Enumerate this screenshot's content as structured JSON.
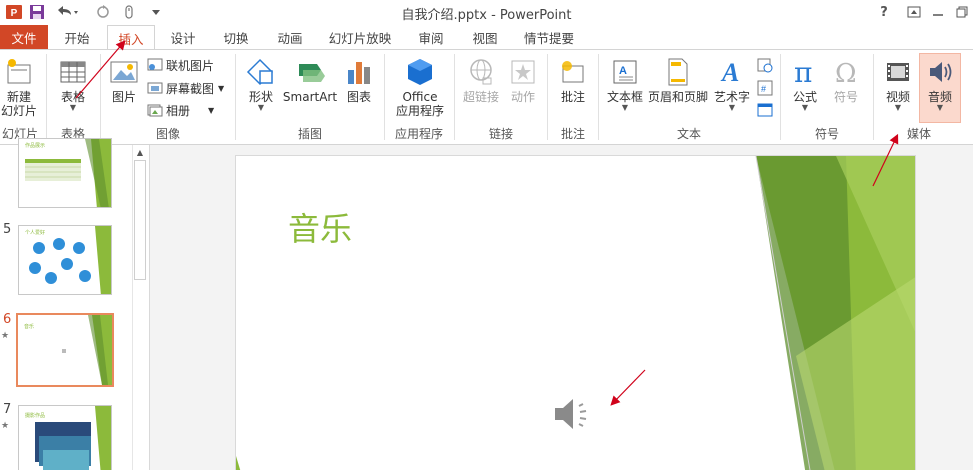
{
  "window": {
    "title": "自我介绍.pptx - PowerPoint",
    "help": "?"
  },
  "tabs": [
    {
      "label": "文件"
    },
    {
      "label": "开始"
    },
    {
      "label": "插入"
    },
    {
      "label": "设计"
    },
    {
      "label": "切换"
    },
    {
      "label": "动画"
    },
    {
      "label": "幻灯片放映"
    },
    {
      "label": "审阅"
    },
    {
      "label": "视图"
    },
    {
      "label": "情节提要"
    }
  ],
  "ribbon": {
    "slides": {
      "new_slide_1": "新建",
      "new_slide_2": "幻灯片",
      "group": "幻灯片"
    },
    "tables": {
      "table": "表格",
      "group": "表格"
    },
    "images": {
      "picture": "图片",
      "online_pictures": "联机图片",
      "screenshot": "屏幕截图",
      "album": "相册",
      "group": "图像"
    },
    "illustrations": {
      "shapes": "形状",
      "smartart": "SmartArt",
      "chart": "图表",
      "group": "插图"
    },
    "apps": {
      "office_1": "Office",
      "office_2": "应用程序",
      "group": "应用程序"
    },
    "links": {
      "hyperlink": "超链接",
      "action": "动作",
      "group": "链接"
    },
    "comments": {
      "comment": "批注",
      "group": "批注"
    },
    "text": {
      "textbox": "文本框",
      "header_footer": "页眉和页脚",
      "wordart": "艺术字",
      "group": "文本"
    },
    "symbols": {
      "equation": "公式",
      "symbol": "符号",
      "group": "符号"
    },
    "media": {
      "video": "视频",
      "audio": "音频",
      "group": "媒体"
    }
  },
  "thumbnails": [
    {
      "number": "",
      "title": "作品展示"
    },
    {
      "number": "5",
      "title": "个人爱好"
    },
    {
      "number": "6",
      "title": "音乐",
      "star": "★"
    },
    {
      "number": "7",
      "title": "摄影作品",
      "star": "★"
    }
  ],
  "slide": {
    "title": "音乐"
  },
  "colors": {
    "accent_orange": "#d24726",
    "slide_green": "#8cba3b",
    "annotation_red": "#d0021b"
  },
  "icons": [
    "app-logo-icon",
    "save-icon",
    "undo-icon",
    "redo-icon",
    "touch-mode-icon",
    "speaker-icon"
  ]
}
